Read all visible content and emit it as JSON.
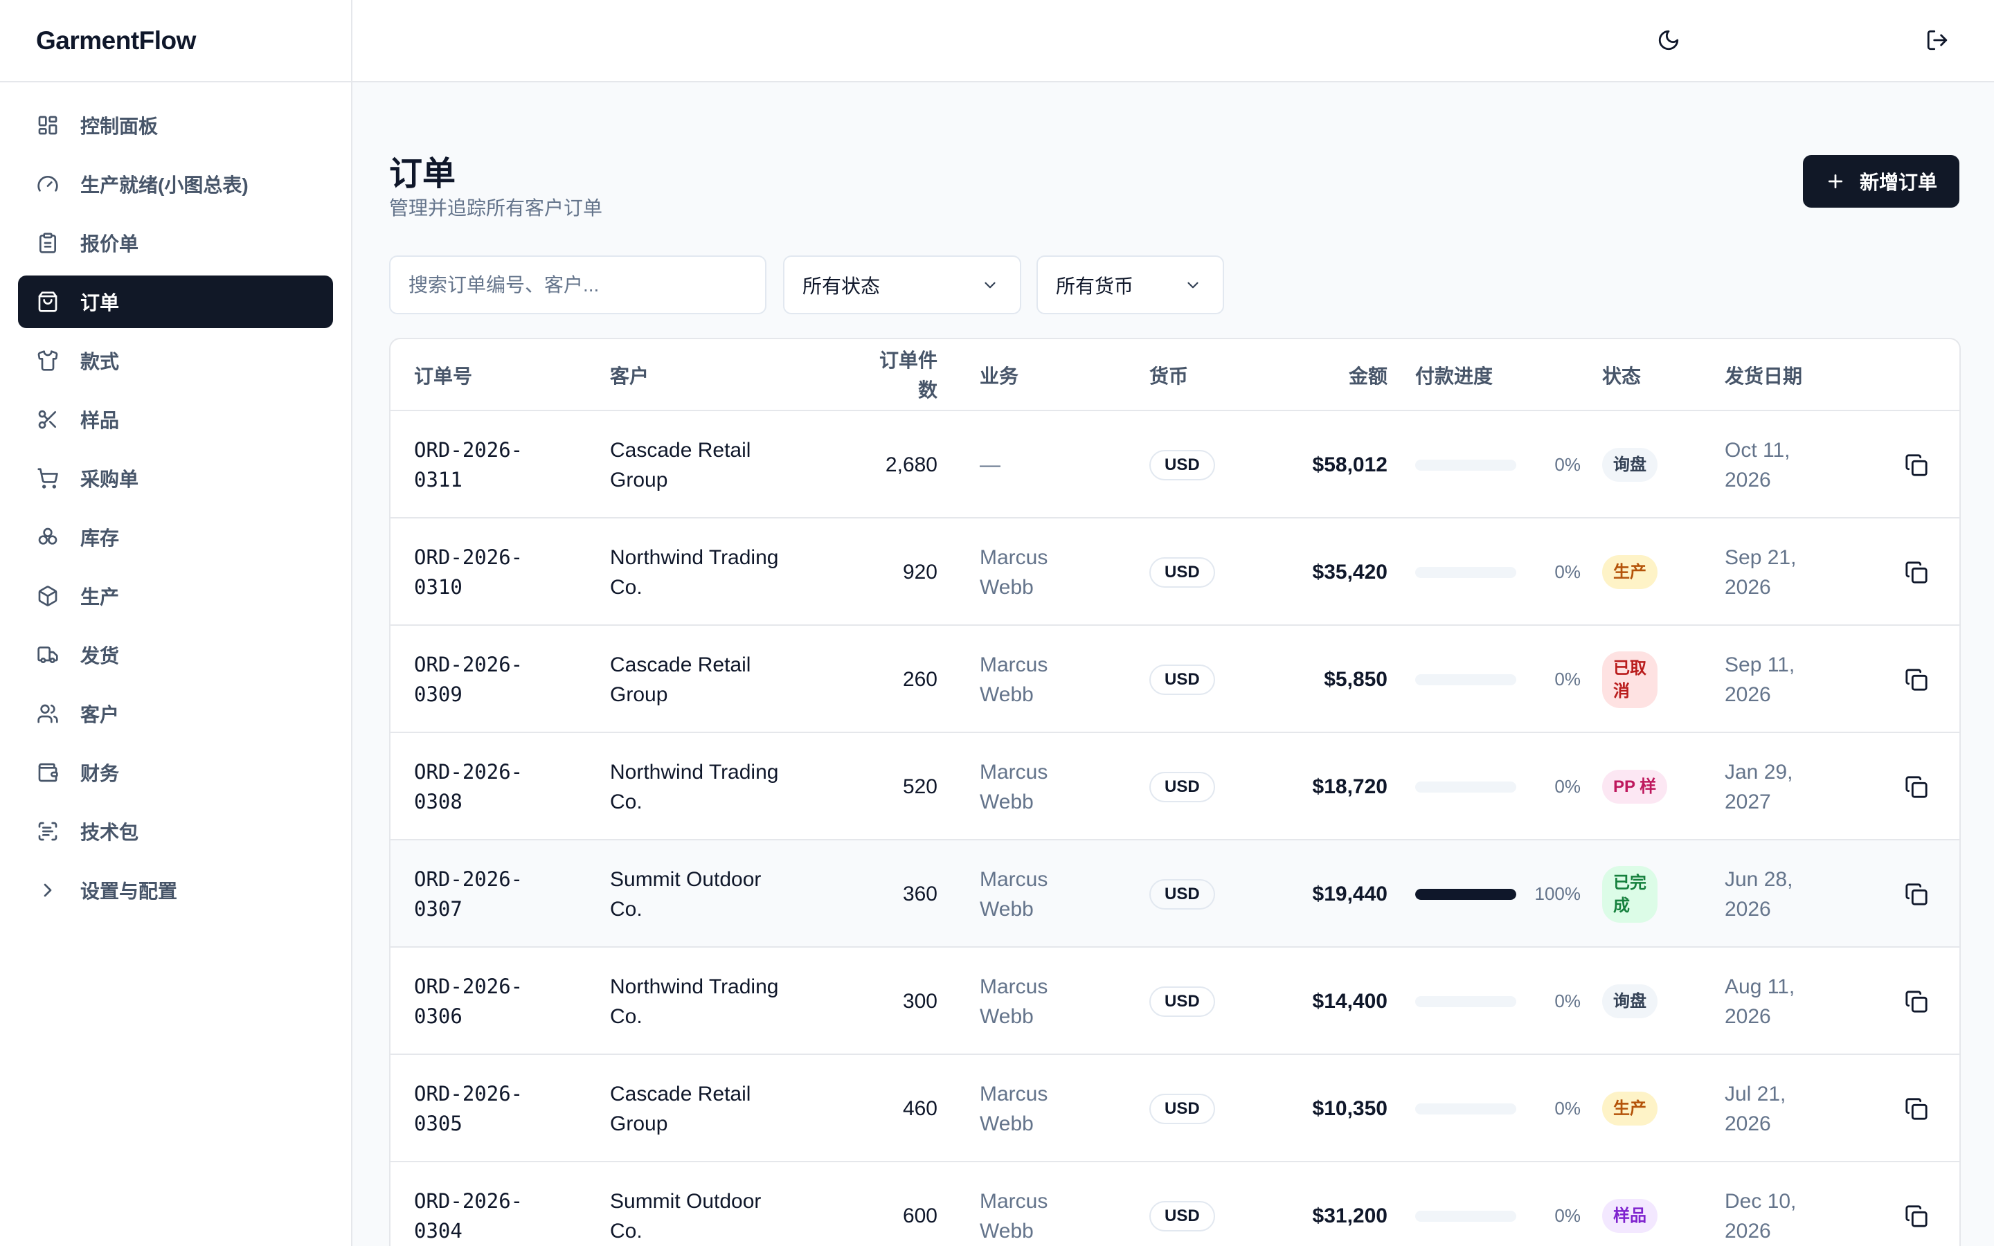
{
  "app": {
    "brand": "GarmentFlow"
  },
  "sidebar": {
    "items": [
      {
        "label": "控制面板",
        "icon": "dashboard-icon",
        "active": false
      },
      {
        "label": "生产就绪(小图总表)",
        "icon": "gauge-icon",
        "active": false
      },
      {
        "label": "报价单",
        "icon": "clipboard-icon",
        "active": false
      },
      {
        "label": "订单",
        "icon": "shopping-bag-icon",
        "active": true
      },
      {
        "label": "款式",
        "icon": "shirt-icon",
        "active": false
      },
      {
        "label": "样品",
        "icon": "scissors-icon",
        "active": false
      },
      {
        "label": "采购单",
        "icon": "cart-icon",
        "active": false
      },
      {
        "label": "库存",
        "icon": "layers-icon",
        "active": false
      },
      {
        "label": "生产",
        "icon": "package-icon",
        "active": false
      },
      {
        "label": "发货",
        "icon": "truck-icon",
        "active": false
      },
      {
        "label": "客户",
        "icon": "users-icon",
        "active": false
      },
      {
        "label": "财务",
        "icon": "wallet-icon",
        "active": false
      },
      {
        "label": "技术包",
        "icon": "scan-text-icon",
        "active": false
      },
      {
        "label": "设置与配置",
        "icon": "chevron-right-icon",
        "active": false
      }
    ]
  },
  "topbar": {
    "theme_icon": "moon-icon",
    "logout_icon": "logout-icon"
  },
  "page": {
    "title": "订单",
    "subtitle": "管理并追踪所有客户订单",
    "new_button_label": "新增订单"
  },
  "filters": {
    "search_placeholder": "搜索订单编号、客户...",
    "status_select": "所有状态",
    "currency_select": "所有货币"
  },
  "table": {
    "columns": {
      "order_no": "订单号",
      "customer": "客户",
      "qty_line1": "订单件",
      "qty_line2": "数",
      "business": "业务",
      "currency": "货币",
      "amount": "金额",
      "progress": "付款进度",
      "status": "状态",
      "ship_date": "发货日期"
    },
    "rows": [
      {
        "id1": "ORD-2026-",
        "id2": "0311",
        "cust1": "Cascade Retail",
        "cust2": "Group",
        "qty": "2,680",
        "biz1": "—",
        "biz2": "",
        "currency": "USD",
        "amount": "$58,012",
        "progress": 0,
        "pct": "0%",
        "st1": "询盘",
        "st2": "",
        "status_color": "#f1f5f9",
        "status_text_color": "#334155",
        "date1": "Oct 11,",
        "date2": "2026",
        "highlight": false
      },
      {
        "id1": "ORD-2026-",
        "id2": "0310",
        "cust1": "Northwind Trading",
        "cust2": "Co.",
        "qty": "920",
        "biz1": "Marcus",
        "biz2": "Webb",
        "currency": "USD",
        "amount": "$35,420",
        "progress": 0,
        "pct": "0%",
        "st1": "生产",
        "st2": "",
        "status_color": "#fef3c7",
        "status_text_color": "#b45309",
        "date1": "Sep 21,",
        "date2": "2026",
        "highlight": false
      },
      {
        "id1": "ORD-2026-",
        "id2": "0309",
        "cust1": "Cascade Retail",
        "cust2": "Group",
        "qty": "260",
        "biz1": "Marcus",
        "biz2": "Webb",
        "currency": "USD",
        "amount": "$5,850",
        "progress": 0,
        "pct": "0%",
        "st1": "已取",
        "st2": "消",
        "status_color": "#fee2e2",
        "status_text_color": "#b91c1c",
        "date1": "Sep 11,",
        "date2": "2026",
        "highlight": false
      },
      {
        "id1": "ORD-2026-",
        "id2": "0308",
        "cust1": "Northwind Trading",
        "cust2": "Co.",
        "qty": "520",
        "biz1": "Marcus",
        "biz2": "Webb",
        "currency": "USD",
        "amount": "$18,720",
        "progress": 0,
        "pct": "0%",
        "st1": "PP 样",
        "st2": "",
        "status_color": "#fce7f3",
        "status_text_color": "#be185d",
        "date1": "Jan 29,",
        "date2": "2027",
        "highlight": false
      },
      {
        "id1": "ORD-2026-",
        "id2": "0307",
        "cust1": "Summit Outdoor Co.",
        "cust2": "",
        "qty": "360",
        "biz1": "Marcus",
        "biz2": "Webb",
        "currency": "USD",
        "amount": "$19,440",
        "progress": 100,
        "pct": "100%",
        "st1": "已完",
        "st2": "成",
        "status_color": "#dcfce7",
        "status_text_color": "#15803d",
        "date1": "Jun 28,",
        "date2": "2026",
        "highlight": true
      },
      {
        "id1": "ORD-2026-",
        "id2": "0306",
        "cust1": "Northwind Trading",
        "cust2": "Co.",
        "qty": "300",
        "biz1": "Marcus",
        "biz2": "Webb",
        "currency": "USD",
        "amount": "$14,400",
        "progress": 0,
        "pct": "0%",
        "st1": "询盘",
        "st2": "",
        "status_color": "#f1f5f9",
        "status_text_color": "#334155",
        "date1": "Aug 11,",
        "date2": "2026",
        "highlight": false
      },
      {
        "id1": "ORD-2026-",
        "id2": "0305",
        "cust1": "Cascade Retail",
        "cust2": "Group",
        "qty": "460",
        "biz1": "Marcus",
        "biz2": "Webb",
        "currency": "USD",
        "amount": "$10,350",
        "progress": 0,
        "pct": "0%",
        "st1": "生产",
        "st2": "",
        "status_color": "#fef3c7",
        "status_text_color": "#b45309",
        "date1": "Jul 21, 2026",
        "date2": "",
        "highlight": false
      },
      {
        "id1": "ORD-2026-",
        "id2": "0304",
        "cust1": "Summit Outdoor Co.",
        "cust2": "",
        "qty": "600",
        "biz1": "Marcus",
        "biz2": "Webb",
        "currency": "USD",
        "amount": "$31,200",
        "progress": 0,
        "pct": "0%",
        "st1": "样品",
        "st2": "",
        "status_color": "#f3e8ff",
        "status_text_color": "#7e22ce",
        "date1": "Dec 10,",
        "date2": "2026",
        "highlight": false
      }
    ]
  }
}
